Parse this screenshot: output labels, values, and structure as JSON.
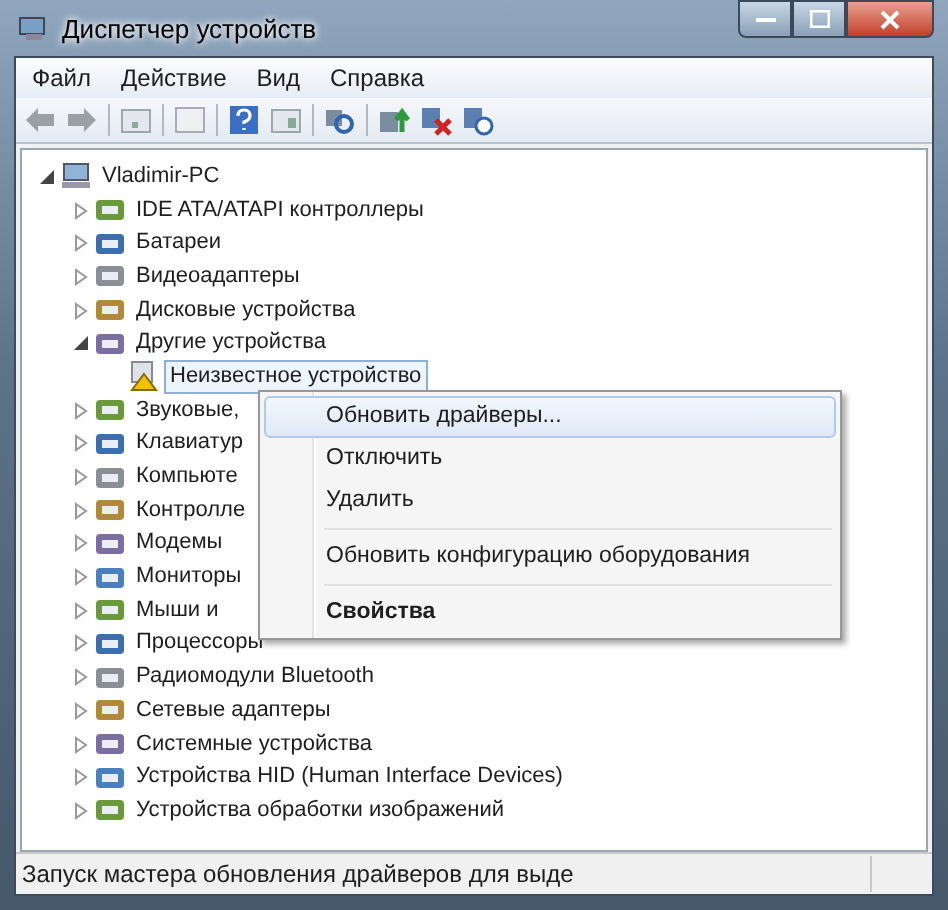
{
  "window": {
    "title": "Диспетчер устройств"
  },
  "menu_bar": [
    "Файл",
    "Действие",
    "Вид",
    "Справка"
  ],
  "tree": [
    {
      "label": "Vladimir-PC",
      "expanded": true,
      "children": [
        {
          "label": "IDE ATA/ATAPI контроллеры",
          "expanded": false
        },
        {
          "label": "Батареи",
          "expanded": false
        },
        {
          "label": "Видеоадаптеры",
          "expanded": false
        },
        {
          "label": "Дисковые устройства",
          "expanded": false
        },
        {
          "label": "Другие устройства",
          "expanded": true,
          "children": [
            {
              "label": "Неизвестное устройство",
              "warning": true,
              "selected": true
            }
          ]
        },
        {
          "label": "Звуковые,",
          "expanded": false
        },
        {
          "label": "Клавиатур",
          "expanded": false
        },
        {
          "label": "Компьюте",
          "expanded": false
        },
        {
          "label": "Контролле",
          "expanded": false
        },
        {
          "label": "Модемы",
          "expanded": false
        },
        {
          "label": "Мониторы",
          "expanded": false
        },
        {
          "label": "Мыши и",
          "expanded": false
        },
        {
          "label": "Процессоры",
          "expanded": false
        },
        {
          "label": "Радиомодули Bluetooth",
          "expanded": false
        },
        {
          "label": "Сетевые адаптеры",
          "expanded": false
        },
        {
          "label": "Системные устройства",
          "expanded": false
        },
        {
          "label": "Устройства HID (Human Interface Devices)",
          "expanded": false
        },
        {
          "label": "Устройства обработки изображений",
          "expanded": false
        }
      ]
    }
  ],
  "context_menu": [
    {
      "kind": "item",
      "label": "Обновить драйверы...",
      "selected": true,
      "default": false
    },
    {
      "kind": "item",
      "label": "Отключить",
      "selected": false,
      "default": false
    },
    {
      "kind": "item",
      "label": "Удалить",
      "selected": false,
      "default": false
    },
    {
      "kind": "separator"
    },
    {
      "kind": "item",
      "label": "Обновить конфигурацию оборудования",
      "selected": false,
      "default": false
    },
    {
      "kind": "separator"
    },
    {
      "kind": "item",
      "label": "Свойства",
      "selected": false,
      "default": true
    }
  ],
  "status_bar": "Запуск мастера обновления драйверов для выде"
}
